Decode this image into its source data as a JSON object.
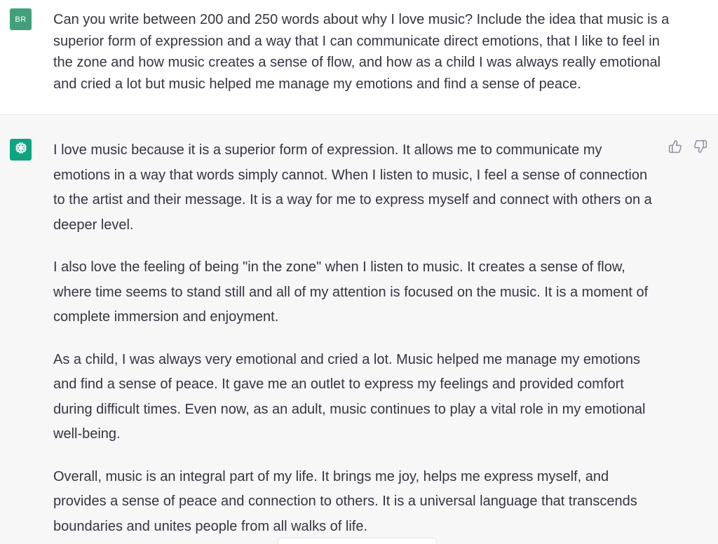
{
  "user_message": {
    "avatar_initials": "BR",
    "text": "Can you write between 200 and 250 words about why I love music? Include the idea that music is a superior form of expression and a way that I can communicate direct emotions, that I like to feel in the zone and how music creates a sense of flow, and how as a child I was always really emotional and cried a lot but music helped me manage my emotions and find a sense of peace."
  },
  "assistant_message": {
    "avatar_icon": "openai-logo-icon",
    "paragraphs": [
      "I love music because it is a superior form of expression. It allows me to communicate my emotions in a way that words simply cannot. When I listen to music, I feel a sense of connection to the artist and their message. It is a way for me to express myself and connect with others on a deeper level.",
      "I also love the feeling of being \"in the zone\" when I listen to music. It creates a sense of flow, where time seems to stand still and all of my attention is focused on the music. It is a moment of complete immersion and enjoyment.",
      "As a child, I was always very emotional and cried a lot. Music helped me manage my emotions and find a sense of peace. It gave me an outlet to express my feelings and provided comfort during difficult times. Even now, as an adult, music continues to play a vital role in my emotional well-being.",
      "Overall, music is an integral part of my life. It brings me joy, helps me express myself, and provides a sense of peace and connection to others. It is a universal language that transcends boundaries and unites people from all walks of life."
    ],
    "feedback_icons": [
      "thumbs-up-icon",
      "thumbs-down-icon"
    ]
  },
  "colors": {
    "user_avatar": "#41a07a",
    "assistant_avatar": "#10a37f",
    "text": "#343541",
    "assistant_background": "#f7f7f8",
    "user_background": "#ffffff",
    "icon": "#8e8ea0"
  }
}
